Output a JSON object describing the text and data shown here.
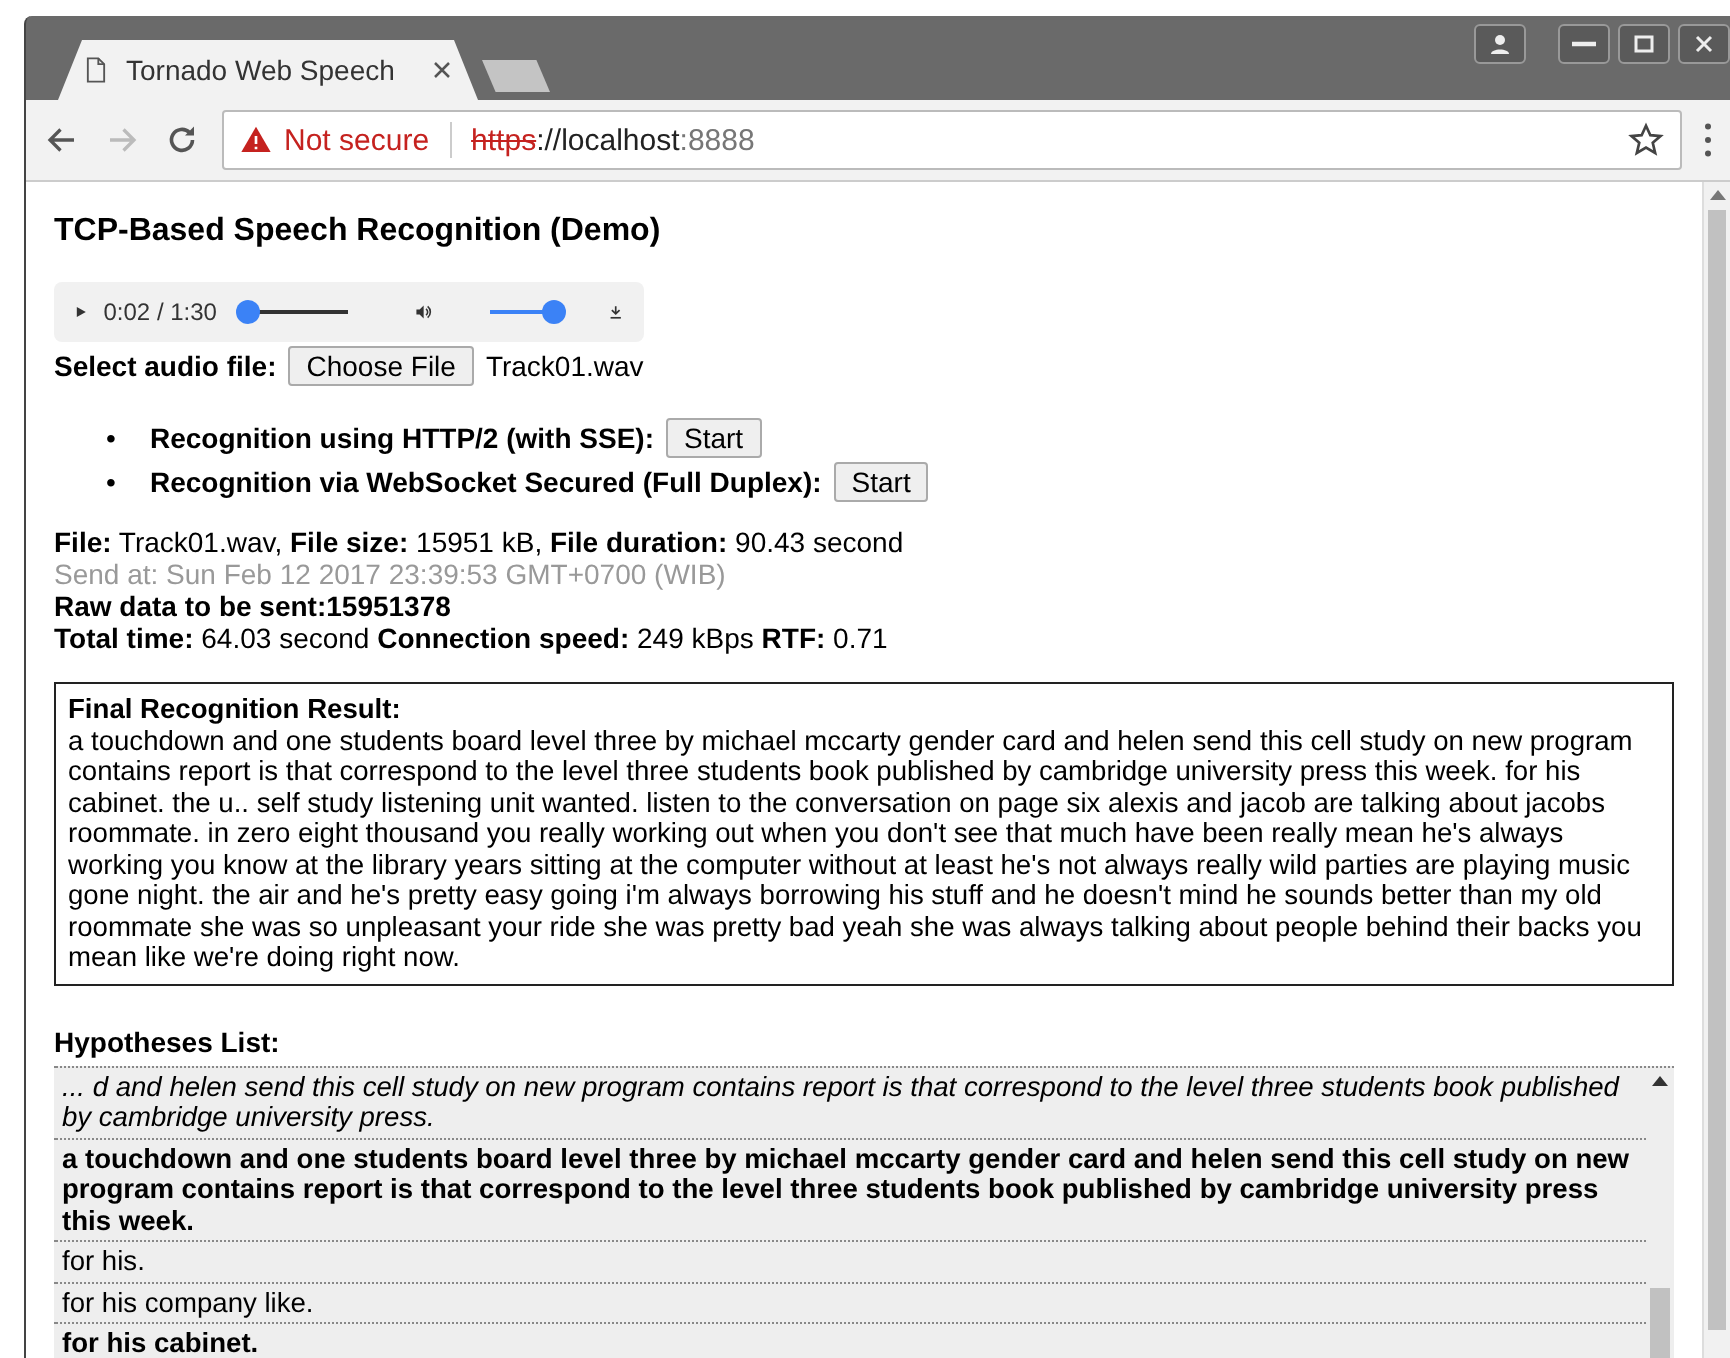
{
  "tab": {
    "title": "Tornado Web Speech",
    "selected": true
  },
  "address": {
    "security": "Not secure",
    "scheme": "https",
    "host": "://localhost",
    "port": ":8888",
    "forward_disabled": true
  },
  "page": {
    "heading": "TCP-Based Speech Recognition (Demo)",
    "player": {
      "time": "0:02 / 1:30",
      "progress": {
        "level": 0.02
      },
      "volume": {
        "level": 1.0
      }
    },
    "file_select": {
      "label": "Select audio file:",
      "button": "Choose File",
      "file_name": "Track01.wav"
    },
    "methods": [
      {
        "marker": "•",
        "label": "Recognition using HTTP/2 (with SSE):",
        "button": "Start"
      },
      {
        "marker": "•",
        "label": "Recognition via WebSocket Secured (Full Duplex):",
        "button": "Start"
      }
    ],
    "info": [
      {
        "kind": "normal",
        "text": "**File:** Track01.wav, **File size:** 15951 kB, **File duration:** 90.43 second"
      },
      {
        "kind": "muted",
        "text": "Send at: Sun Feb 12 2017 23:39:53 GMT+0700 (WIB)"
      },
      {
        "kind": "normal",
        "text": "**Raw data to be sent:15951378**"
      },
      {
        "kind": "normal",
        "text": "**Total time:** 64.03 second **Connection speed:** 249 kBps **RTF:** 0.71"
      }
    ],
    "result": {
      "title": "Final Recognition Result:",
      "text": "a touchdown and one students board level three by michael mccarty gender card and helen send this cell study on new program contains report is that correspond to the level three students book published by cambridge university press this week. for his cabinet. the u.. self study listening unit wanted. listen to the conversation on page six alexis and jacob are talking about jacobs roommate. in zero eight thousand you really working out when you don't see that much have been really mean he's always working you know at the library years sitting at the computer without at least he's not always really wild parties are playing music gone night. the air and he's pretty easy going i'm always borrowing his stuff and he doesn't mind he sounds better than my old roommate she was so unpleasant your ride she was pretty bad yeah she was always talking about people behind their backs you mean like we're doing right now."
    },
    "hypotheses": {
      "title": "Hypotheses List:",
      "items": [
        {
          "kind": "partial",
          "text": "... d and helen send this cell study on new program contains report is that correspond to the level three students book published by cambridge university press."
        },
        {
          "kind": "final",
          "text": "a touchdown and one students board level three by michael mccarty gender card and helen send this cell study on new program contains report is that correspond to the level three students book published by cambridge university press this week."
        },
        {
          "kind": "interim",
          "text": "for his."
        },
        {
          "kind": "interim",
          "text": "for his company like."
        },
        {
          "kind": "final",
          "text": "for his cabinet."
        }
      ]
    }
  }
}
